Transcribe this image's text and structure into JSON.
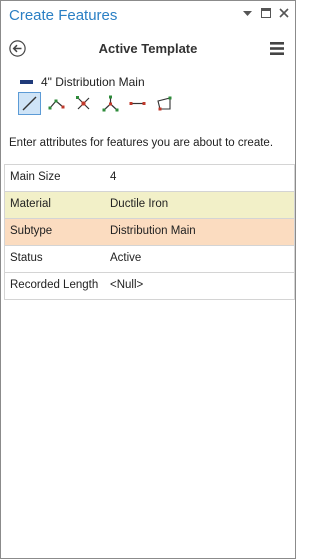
{
  "window": {
    "title": "Create Features",
    "dropdown_icon": "caret-down-icon",
    "restore_icon": "restore-window-icon",
    "close_icon": "close-icon",
    "title_color": "#2a7fc4"
  },
  "header": {
    "title": "Active Template",
    "back_icon": "back-arrow-icon",
    "menu_icon": "hamburger-menu-icon"
  },
  "template": {
    "name": "4\" Distribution Main",
    "swatch_color": "#1f3a7a"
  },
  "tools": [
    {
      "name": "line-tool",
      "active": true
    },
    {
      "name": "polyline-tool",
      "active": false
    },
    {
      "name": "intersection-tool",
      "active": false
    },
    {
      "name": "vertex-tool",
      "active": false
    },
    {
      "name": "two-point-line-tool",
      "active": false
    },
    {
      "name": "polygon-tool",
      "active": false
    }
  ],
  "instructions": "Enter attributes for features you are about to create.",
  "attributes": [
    {
      "key": "Main Size",
      "value": "4",
      "highlight": ""
    },
    {
      "key": "Material",
      "value": "Ductile Iron",
      "highlight": "yellow"
    },
    {
      "key": "Subtype",
      "value": "Distribution Main",
      "highlight": "orange"
    },
    {
      "key": "Status",
      "value": "Active",
      "highlight": ""
    },
    {
      "key": "Recorded Length",
      "value": "<Null>",
      "highlight": ""
    }
  ],
  "colors": {
    "highlight_yellow": "#f2f0c8",
    "highlight_orange": "#fbdcc0",
    "active_tool_bg": "#cfe4f7"
  }
}
